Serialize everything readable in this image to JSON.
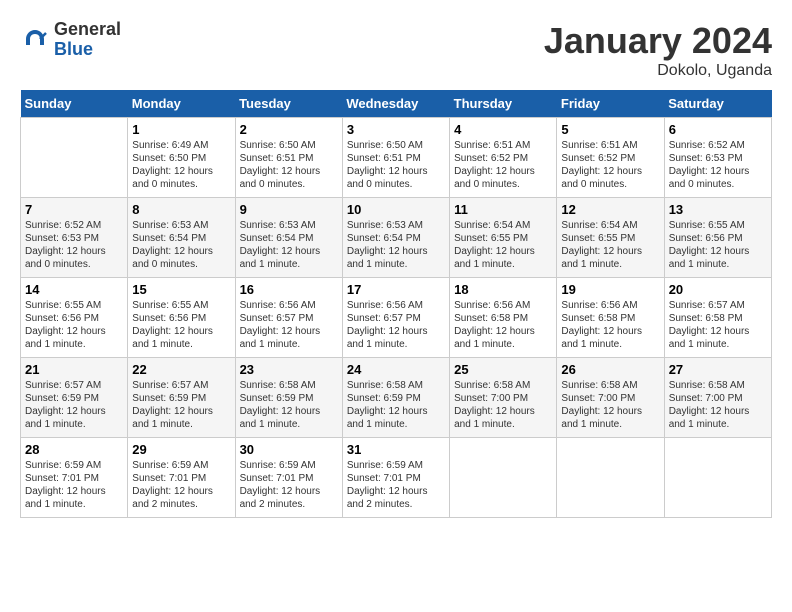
{
  "header": {
    "logo_general": "General",
    "logo_blue": "Blue",
    "month_title": "January 2024",
    "location": "Dokolo, Uganda"
  },
  "days_of_week": [
    "Sunday",
    "Monday",
    "Tuesday",
    "Wednesday",
    "Thursday",
    "Friday",
    "Saturday"
  ],
  "weeks": [
    [
      {
        "day": "",
        "info": ""
      },
      {
        "day": "1",
        "info": "Sunrise: 6:49 AM\nSunset: 6:50 PM\nDaylight: 12 hours\nand 0 minutes."
      },
      {
        "day": "2",
        "info": "Sunrise: 6:50 AM\nSunset: 6:51 PM\nDaylight: 12 hours\nand 0 minutes."
      },
      {
        "day": "3",
        "info": "Sunrise: 6:50 AM\nSunset: 6:51 PM\nDaylight: 12 hours\nand 0 minutes."
      },
      {
        "day": "4",
        "info": "Sunrise: 6:51 AM\nSunset: 6:52 PM\nDaylight: 12 hours\nand 0 minutes."
      },
      {
        "day": "5",
        "info": "Sunrise: 6:51 AM\nSunset: 6:52 PM\nDaylight: 12 hours\nand 0 minutes."
      },
      {
        "day": "6",
        "info": "Sunrise: 6:52 AM\nSunset: 6:53 PM\nDaylight: 12 hours\nand 0 minutes."
      }
    ],
    [
      {
        "day": "7",
        "info": "Sunrise: 6:52 AM\nSunset: 6:53 PM\nDaylight: 12 hours\nand 0 minutes."
      },
      {
        "day": "8",
        "info": "Sunrise: 6:53 AM\nSunset: 6:54 PM\nDaylight: 12 hours\nand 0 minutes."
      },
      {
        "day": "9",
        "info": "Sunrise: 6:53 AM\nSunset: 6:54 PM\nDaylight: 12 hours\nand 1 minute."
      },
      {
        "day": "10",
        "info": "Sunrise: 6:53 AM\nSunset: 6:54 PM\nDaylight: 12 hours\nand 1 minute."
      },
      {
        "day": "11",
        "info": "Sunrise: 6:54 AM\nSunset: 6:55 PM\nDaylight: 12 hours\nand 1 minute."
      },
      {
        "day": "12",
        "info": "Sunrise: 6:54 AM\nSunset: 6:55 PM\nDaylight: 12 hours\nand 1 minute."
      },
      {
        "day": "13",
        "info": "Sunrise: 6:55 AM\nSunset: 6:56 PM\nDaylight: 12 hours\nand 1 minute."
      }
    ],
    [
      {
        "day": "14",
        "info": "Sunrise: 6:55 AM\nSunset: 6:56 PM\nDaylight: 12 hours\nand 1 minute."
      },
      {
        "day": "15",
        "info": "Sunrise: 6:55 AM\nSunset: 6:56 PM\nDaylight: 12 hours\nand 1 minute."
      },
      {
        "day": "16",
        "info": "Sunrise: 6:56 AM\nSunset: 6:57 PM\nDaylight: 12 hours\nand 1 minute."
      },
      {
        "day": "17",
        "info": "Sunrise: 6:56 AM\nSunset: 6:57 PM\nDaylight: 12 hours\nand 1 minute."
      },
      {
        "day": "18",
        "info": "Sunrise: 6:56 AM\nSunset: 6:58 PM\nDaylight: 12 hours\nand 1 minute."
      },
      {
        "day": "19",
        "info": "Sunrise: 6:56 AM\nSunset: 6:58 PM\nDaylight: 12 hours\nand 1 minute."
      },
      {
        "day": "20",
        "info": "Sunrise: 6:57 AM\nSunset: 6:58 PM\nDaylight: 12 hours\nand 1 minute."
      }
    ],
    [
      {
        "day": "21",
        "info": "Sunrise: 6:57 AM\nSunset: 6:59 PM\nDaylight: 12 hours\nand 1 minute."
      },
      {
        "day": "22",
        "info": "Sunrise: 6:57 AM\nSunset: 6:59 PM\nDaylight: 12 hours\nand 1 minute."
      },
      {
        "day": "23",
        "info": "Sunrise: 6:58 AM\nSunset: 6:59 PM\nDaylight: 12 hours\nand 1 minute."
      },
      {
        "day": "24",
        "info": "Sunrise: 6:58 AM\nSunset: 6:59 PM\nDaylight: 12 hours\nand 1 minute."
      },
      {
        "day": "25",
        "info": "Sunrise: 6:58 AM\nSunset: 7:00 PM\nDaylight: 12 hours\nand 1 minute."
      },
      {
        "day": "26",
        "info": "Sunrise: 6:58 AM\nSunset: 7:00 PM\nDaylight: 12 hours\nand 1 minute."
      },
      {
        "day": "27",
        "info": "Sunrise: 6:58 AM\nSunset: 7:00 PM\nDaylight: 12 hours\nand 1 minute."
      }
    ],
    [
      {
        "day": "28",
        "info": "Sunrise: 6:59 AM\nSunset: 7:01 PM\nDaylight: 12 hours\nand 1 minute."
      },
      {
        "day": "29",
        "info": "Sunrise: 6:59 AM\nSunset: 7:01 PM\nDaylight: 12 hours\nand 2 minutes."
      },
      {
        "day": "30",
        "info": "Sunrise: 6:59 AM\nSunset: 7:01 PM\nDaylight: 12 hours\nand 2 minutes."
      },
      {
        "day": "31",
        "info": "Sunrise: 6:59 AM\nSunset: 7:01 PM\nDaylight: 12 hours\nand 2 minutes."
      },
      {
        "day": "",
        "info": ""
      },
      {
        "day": "",
        "info": ""
      },
      {
        "day": "",
        "info": ""
      }
    ]
  ]
}
